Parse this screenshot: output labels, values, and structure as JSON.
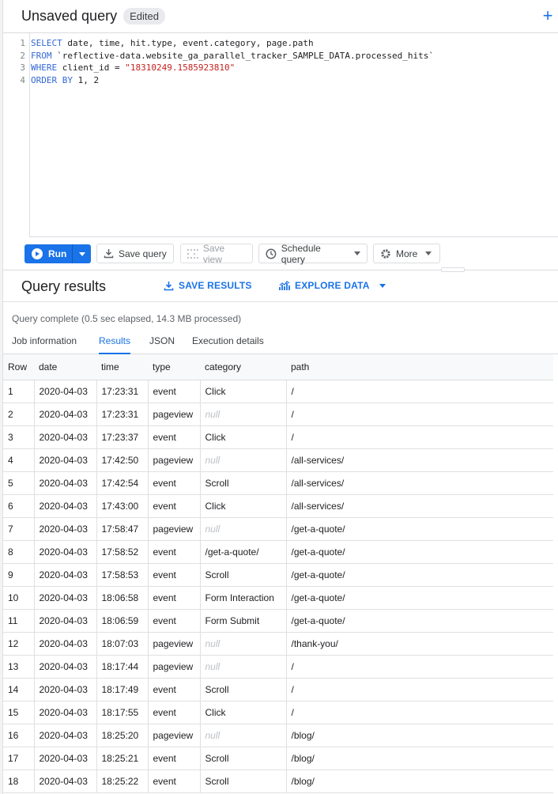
{
  "header": {
    "title": "Unsaved query",
    "badge": "Edited"
  },
  "editor": {
    "lines": [
      {
        "n": "1",
        "parts": [
          {
            "k": "kw",
            "t": "SELECT"
          },
          {
            "k": "txt",
            "t": " date, time, hit.type, event.category, page.path"
          }
        ]
      },
      {
        "n": "2",
        "parts": [
          {
            "k": "kw",
            "t": "FROM"
          },
          {
            "k": "txt",
            "t": " `reflective-data.website_ga_parallel_tracker_SAMPLE_DATA.processed_hits`"
          }
        ]
      },
      {
        "n": "3",
        "parts": [
          {
            "k": "kw",
            "t": "WHERE"
          },
          {
            "k": "txt",
            "t": " client_id = "
          },
          {
            "k": "str",
            "t": "\"18310249.1585923810\""
          }
        ]
      },
      {
        "n": "4",
        "parts": [
          {
            "k": "kw",
            "t": "ORDER BY"
          },
          {
            "k": "txt",
            "t": " 1, 2"
          }
        ]
      }
    ]
  },
  "toolbar": {
    "run_label": "Run",
    "save_query_label": "Save query",
    "save_view_label": "Save view",
    "schedule_label": "Schedule query",
    "more_label": "More"
  },
  "results": {
    "title": "Query results",
    "save_results_label": "SAVE RESULTS",
    "explore_label": "EXPLORE DATA",
    "status": "Query complete (0.5 sec elapsed, 14.3 MB processed)"
  },
  "tabs": [
    "Job information",
    "Results",
    "JSON",
    "Execution details"
  ],
  "table": {
    "columns": [
      "Row",
      "date",
      "time",
      "type",
      "category",
      "path"
    ],
    "rows": [
      [
        "1",
        "2020-04-03",
        "17:23:31",
        "event",
        "Click",
        "/"
      ],
      [
        "2",
        "2020-04-03",
        "17:23:31",
        "pageview",
        "null",
        "/"
      ],
      [
        "3",
        "2020-04-03",
        "17:23:37",
        "event",
        "Click",
        "/"
      ],
      [
        "4",
        "2020-04-03",
        "17:42:50",
        "pageview",
        "null",
        "/all-services/"
      ],
      [
        "5",
        "2020-04-03",
        "17:42:54",
        "event",
        "Scroll",
        "/all-services/"
      ],
      [
        "6",
        "2020-04-03",
        "17:43:00",
        "event",
        "Click",
        "/all-services/"
      ],
      [
        "7",
        "2020-04-03",
        "17:58:47",
        "pageview",
        "null",
        "/get-a-quote/"
      ],
      [
        "8",
        "2020-04-03",
        "17:58:52",
        "event",
        "/get-a-quote/",
        "/get-a-quote/"
      ],
      [
        "9",
        "2020-04-03",
        "17:58:53",
        "event",
        "Scroll",
        "/get-a-quote/"
      ],
      [
        "10",
        "2020-04-03",
        "18:06:58",
        "event",
        "Form Interaction",
        "/get-a-quote/"
      ],
      [
        "11",
        "2020-04-03",
        "18:06:59",
        "event",
        "Form Submit",
        "/get-a-quote/"
      ],
      [
        "12",
        "2020-04-03",
        "18:07:03",
        "pageview",
        "null",
        "/thank-you/"
      ],
      [
        "13",
        "2020-04-03",
        "18:17:44",
        "pageview",
        "null",
        "/"
      ],
      [
        "14",
        "2020-04-03",
        "18:17:49",
        "event",
        "Scroll",
        "/"
      ],
      [
        "15",
        "2020-04-03",
        "18:17:55",
        "event",
        "Click",
        "/"
      ],
      [
        "16",
        "2020-04-03",
        "18:25:20",
        "pageview",
        "null",
        "/blog/"
      ],
      [
        "17",
        "2020-04-03",
        "18:25:21",
        "event",
        "Scroll",
        "/blog/"
      ],
      [
        "18",
        "2020-04-03",
        "18:25:22",
        "event",
        "Scroll",
        "/blog/"
      ]
    ]
  },
  "colors": {
    "accent": "#1a73e8",
    "null_text": "#bdc1c6",
    "keyword": "#3367d6",
    "string": "#c5221f"
  },
  "icons": [
    "plus-icon",
    "play-icon",
    "caret-down-icon",
    "download-icon",
    "grid-icon",
    "clock-icon",
    "gear-icon",
    "chart-icon"
  ]
}
